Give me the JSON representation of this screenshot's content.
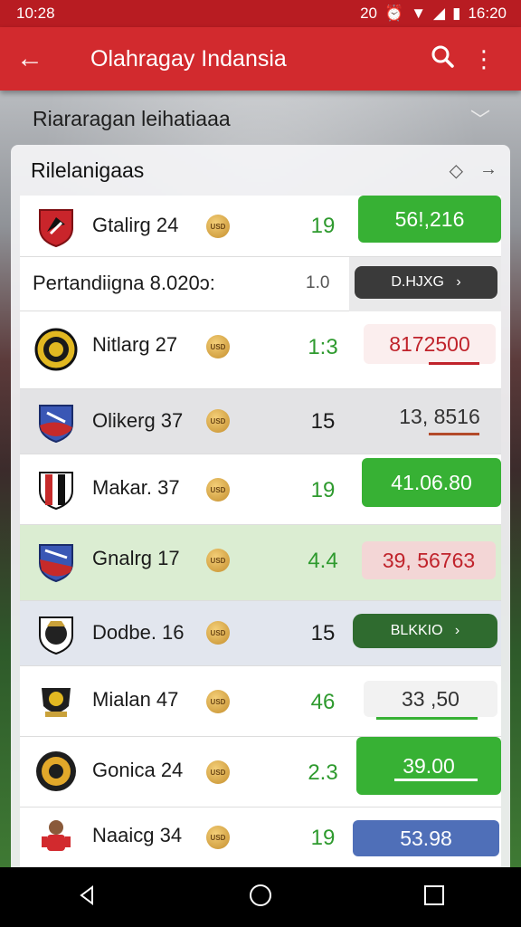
{
  "status": {
    "time": "10:28",
    "right_text": "20",
    "clock": "16:20"
  },
  "appbar": {
    "title": "Olahragay Indansia"
  },
  "subheader": {
    "title": "Riararagan leihatiaaa"
  },
  "card": {
    "title": "Rilelanigaas"
  },
  "match_header": {
    "label": "Pertandiigna 8.020ɔ:",
    "value": "1.0",
    "button": "D.HJXG"
  },
  "rows": [
    {
      "name": "Gtalirg 24",
      "coin": "USD",
      "score": "19",
      "value": "56!,216"
    },
    {
      "name": "Nitlarg 27",
      "coin": "USD",
      "score": "1:3",
      "value": "8172500"
    },
    {
      "name": "Olikerg 37",
      "coin": "USD",
      "score": "15",
      "value": "13, 8516"
    },
    {
      "name": "Makar. 37",
      "coin": "USD",
      "score": "19",
      "value": "41.06.80"
    },
    {
      "name": "Gnalrg 17",
      "coin": "USD",
      "score": "4.4",
      "value": "39, 56763"
    },
    {
      "name": "Dodbe. 16",
      "coin": "USD",
      "score": "15",
      "value": "BLKKIO"
    },
    {
      "name": "Mialan 47",
      "coin": "USD",
      "score": "46",
      "value": "33 ,50"
    },
    {
      "name": "Gonica 24",
      "coin": "USD",
      "score": "2.3",
      "value": "39.00"
    },
    {
      "name": "Naaicg 34",
      "coin": "USD",
      "score": "19",
      "value": "53.98"
    }
  ],
  "colors": {
    "brand_red": "#d22a2e",
    "accent_green": "#37b134",
    "pink_value": "#c0232b"
  }
}
